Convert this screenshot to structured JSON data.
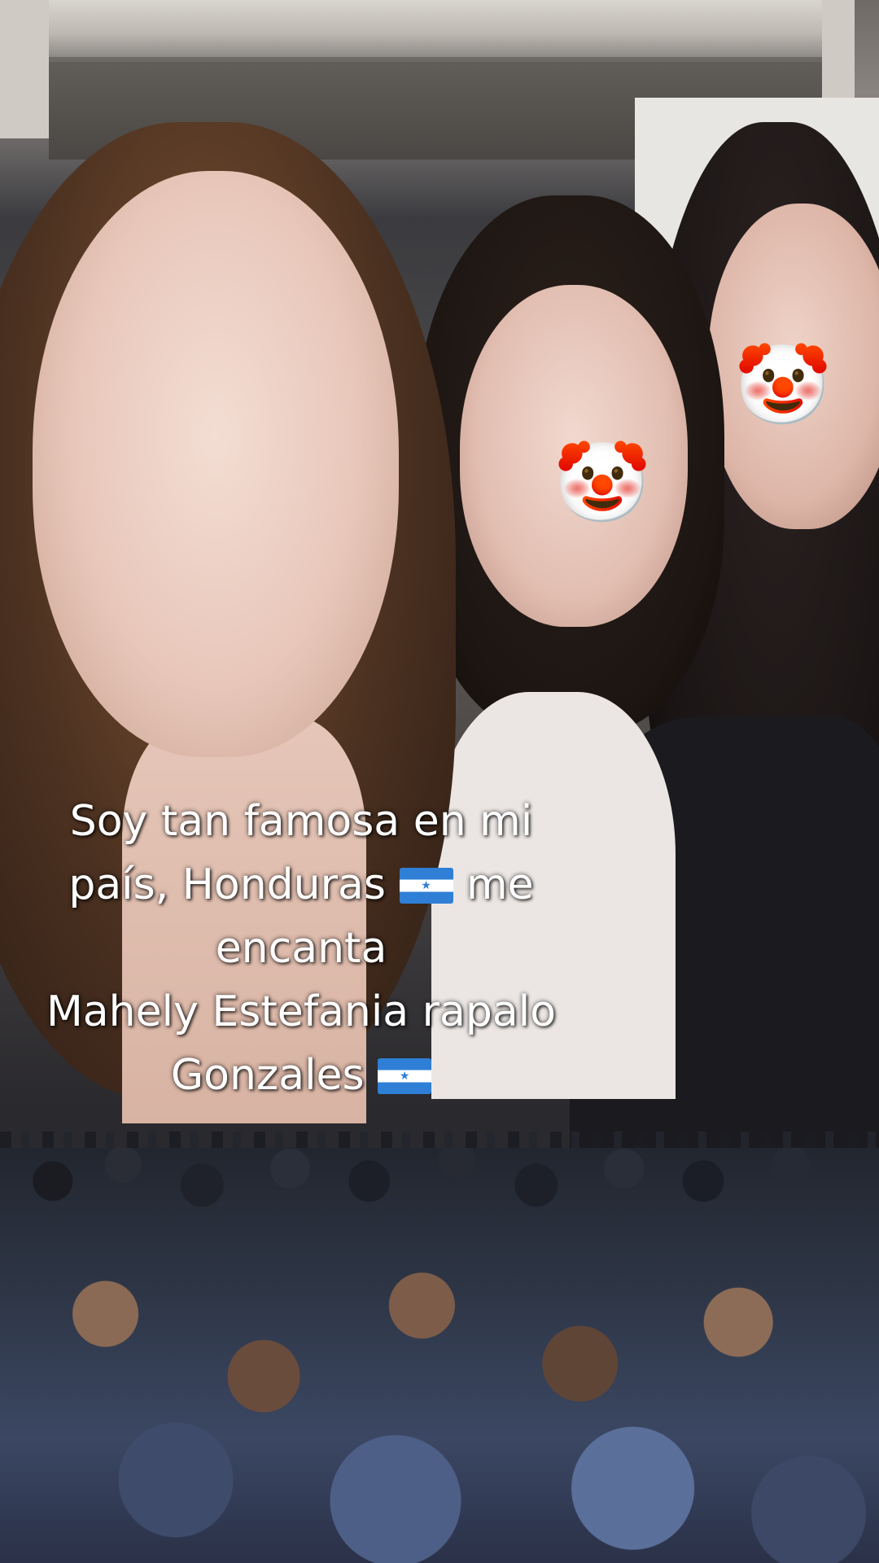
{
  "scene": {
    "description_icons": [
      "clown-face-emoji",
      "clown-face-emoji"
    ],
    "emoji_1": "🤡",
    "emoji_2": "🤡"
  },
  "caption": {
    "line1": "Soy tan famosa en mi",
    "line2_before_flag": "país, Honduras",
    "line2_after_flag": "me",
    "line3": "encanta",
    "line4": "Mahely Estefania rapalo",
    "line5_before_flag": "Gonzales",
    "flag_icon": "honduras-flag-icon"
  },
  "colors": {
    "caption_text": "#ffffff",
    "flag_blue": "#2f7fd6"
  }
}
